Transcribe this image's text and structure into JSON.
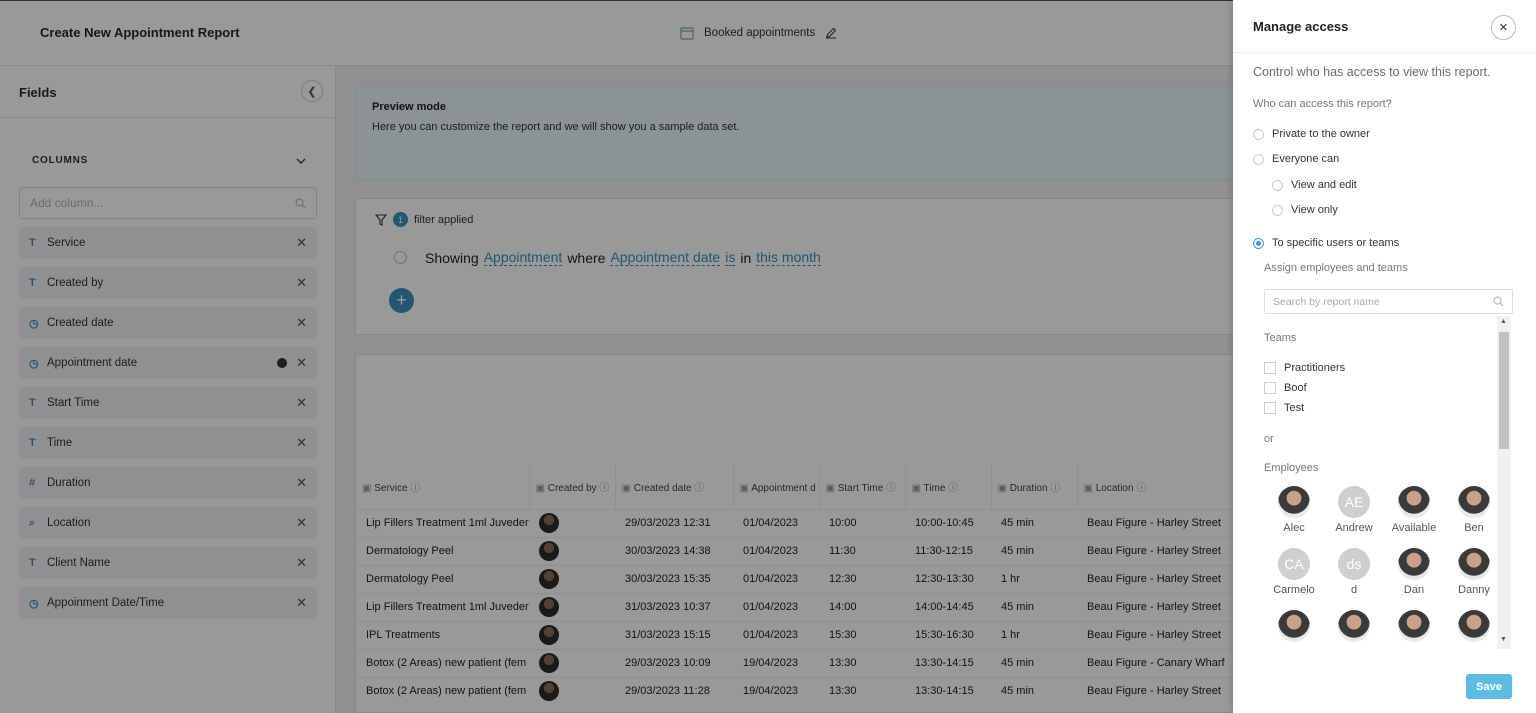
{
  "header": {
    "title": "Create New Appointment Report",
    "report_name": "Booked appointments"
  },
  "sidebar": {
    "title": "Fields",
    "section_label": "COLUMNS",
    "add_column_placeholder": "Add column...",
    "fields": [
      {
        "icon": "T",
        "label": "Service"
      },
      {
        "icon": "T",
        "label": "Created by"
      },
      {
        "icon": "clock",
        "label": "Created date"
      },
      {
        "icon": "clock",
        "label": "Appointment date"
      },
      {
        "icon": "T",
        "label": "Start Time"
      },
      {
        "icon": "T",
        "label": "Time"
      },
      {
        "icon": "#",
        "label": "Duration"
      },
      {
        "icon": "search",
        "label": "Location"
      },
      {
        "icon": "T",
        "label": "Client Name"
      },
      {
        "icon": "clock",
        "label": "Appoinment Date/Time"
      }
    ]
  },
  "preview": {
    "title": "Preview mode",
    "text": "Here you can customize the report and we will show you a sample data set."
  },
  "filter": {
    "count": "1",
    "applied_label": "filter applied",
    "showing": "Showing",
    "entity": "Appointment",
    "where": "where",
    "field": "Appointment date",
    "operator": "is",
    "in": "in",
    "value": "this month"
  },
  "table": {
    "columns": [
      "Service",
      "Created by",
      "Created date",
      "Appointment d",
      "Start Time",
      "Time",
      "Duration",
      "Location"
    ],
    "rows": [
      [
        "Lip Fillers Treatment 1ml Juveder",
        "",
        "29/03/2023 12:31",
        "01/04/2023",
        "10:00",
        "10:00-10:45",
        "45 min",
        "Beau Figure - Harley Street"
      ],
      [
        "Dermatology Peel",
        "",
        "30/03/2023 14:38",
        "01/04/2023",
        "11:30",
        "11:30-12:15",
        "45 min",
        "Beau Figure - Harley Street"
      ],
      [
        "Dermatology Peel",
        "",
        "30/03/2023 15:35",
        "01/04/2023",
        "12:30",
        "12:30-13:30",
        "1 hr",
        "Beau Figure - Harley Street"
      ],
      [
        "Lip Fillers Treatment 1ml Juveder",
        "",
        "31/03/2023 10:37",
        "01/04/2023",
        "14:00",
        "14:00-14:45",
        "45 min",
        "Beau Figure - Harley Street"
      ],
      [
        "IPL Treatments",
        "",
        "31/03/2023 15:15",
        "01/04/2023",
        "15:30",
        "15:30-16:30",
        "1 hr",
        "Beau Figure - Harley Street"
      ],
      [
        "Botox (2 Areas) new patient (fem",
        "",
        "29/03/2023 10:09",
        "19/04/2023",
        "13:30",
        "13:30-14:15",
        "45 min",
        "Beau Figure - Canary Wharf"
      ],
      [
        "Botox (2 Areas) new patient (fem",
        "",
        "29/03/2023 11:28",
        "19/04/2023",
        "13:30",
        "13:30-14:15",
        "45 min",
        "Beau Figure - Harley Street"
      ]
    ]
  },
  "drawer": {
    "title": "Manage access",
    "subtitle": "Control who has access to view this report.",
    "question": "Who can access this report?",
    "options": {
      "private": "Private to the owner",
      "everyone": "Everyone can",
      "view_edit": "View and edit",
      "view_only": "View only",
      "specific": "To specific users or teams"
    },
    "selected_option": "specific",
    "assign_label": "Assign employees and teams",
    "search_placeholder": "Search by report name",
    "teams_label": "Teams",
    "teams": [
      "Practitioners",
      "Boof",
      "Test"
    ],
    "or_label": "or",
    "employees_label": "Employees",
    "employees": [
      {
        "name": "Alec",
        "initials": ""
      },
      {
        "name": "Andrew",
        "initials": "AE"
      },
      {
        "name": "Available",
        "initials": ""
      },
      {
        "name": "Ben",
        "initials": ""
      },
      {
        "name": "Carmelo",
        "initials": "CA"
      },
      {
        "name": "d",
        "initials": "ds"
      },
      {
        "name": "Dan",
        "initials": ""
      },
      {
        "name": "Danny",
        "initials": ""
      },
      {
        "name": "",
        "initials": ""
      },
      {
        "name": "",
        "initials": ""
      },
      {
        "name": "",
        "initials": ""
      },
      {
        "name": "",
        "initials": ""
      }
    ],
    "save_label": "Save"
  },
  "colors": {
    "accent": "#3a8fc0",
    "save_button": "#5bbde6",
    "overlay": "rgba(0,0,0,0.40)"
  }
}
